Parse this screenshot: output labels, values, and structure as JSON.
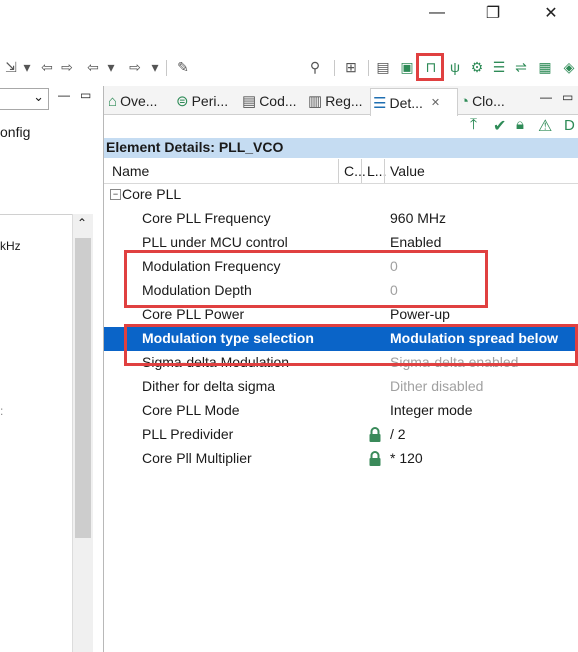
{
  "window": {
    "minimize": "—",
    "restore": "❐",
    "close": "✕"
  },
  "left_panel": {
    "config_text": "onfig",
    "khz_text": "kHz",
    "dropdown_value": ""
  },
  "tabs": [
    {
      "label": "Ove...",
      "icon": "home-icon"
    },
    {
      "label": "Peri...",
      "icon": "peripherals-icon"
    },
    {
      "label": "Cod...",
      "icon": "code-icon"
    },
    {
      "label": "Reg...",
      "icon": "registers-icon"
    },
    {
      "label": "Det...",
      "icon": "details-icon",
      "active": true
    },
    {
      "label": "Clo...",
      "icon": "clock-icon"
    }
  ],
  "details": {
    "header": "Element Details: PLL_VCO",
    "corner_label": "D",
    "columns": {
      "name": "Name",
      "c": "C...",
      "l": "L...",
      "value": "Value"
    },
    "group": "Core PLL",
    "rows": [
      {
        "name": "Core PLL Frequency",
        "value": "960 MHz",
        "disabled": false,
        "locked": false
      },
      {
        "name": "PLL under MCU control",
        "value": "Enabled",
        "disabled": false,
        "locked": false
      },
      {
        "name": "Modulation Frequency",
        "value": "0",
        "disabled": true,
        "locked": false
      },
      {
        "name": "Modulation Depth",
        "value": "0",
        "disabled": true,
        "locked": false
      },
      {
        "name": "Core PLL Power",
        "value": "Power-up",
        "disabled": false,
        "locked": false
      },
      {
        "name": "Modulation type selection",
        "value": "Modulation spread below",
        "disabled": false,
        "locked": false,
        "selected": true
      },
      {
        "name": "Sigma-delta Modulation",
        "value": "Sigma-delta enabled",
        "disabled": true,
        "locked": false
      },
      {
        "name": "Dither for delta sigma",
        "value": "Dither disabled",
        "disabled": true,
        "locked": false
      },
      {
        "name": "Core PLL Mode",
        "value": "Integer mode",
        "disabled": false,
        "locked": false
      },
      {
        "name": "PLL Predivider",
        "value": "/ 2",
        "disabled": false,
        "locked": true
      },
      {
        "name": "Core Pll Multiplier",
        "value": "* 120",
        "disabled": false,
        "locked": true
      }
    ]
  },
  "colors": {
    "selection": "#0a64c8",
    "highlight_box": "#e04040",
    "section_header": "#c5dcf2",
    "icon_green": "#2e8b57"
  }
}
